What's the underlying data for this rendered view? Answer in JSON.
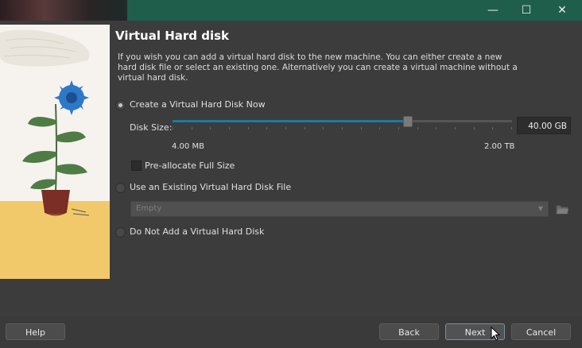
{
  "window": {
    "controls": {
      "minimize": "—",
      "maximize": "☐",
      "close": "✕"
    }
  },
  "dialog": {
    "title": "Virtual Hard disk",
    "description": "If you wish you can add a virtual hard disk to the new machine. You can either create a new hard disk file or select an existing one. Alternatively you can create a virtual machine without a virtual hard disk."
  },
  "options": {
    "create_new": {
      "label": "Create a Virtual Hard Disk Now",
      "selected": true
    },
    "use_existing": {
      "label": "Use an Existing Virtual Hard Disk File",
      "selected": false
    },
    "no_disk": {
      "label": "Do Not Add a Virtual Hard Disk",
      "selected": false
    }
  },
  "disk_size": {
    "label": "Disk Size:",
    "value": "40.00 GB",
    "min_label": "4.00 MB",
    "max_label": "2.00 TB",
    "slider_fraction": 0.69
  },
  "preallocate": {
    "label": "Pre-allocate Full Size",
    "checked": false
  },
  "existing_file": {
    "value": "Empty"
  },
  "buttons": {
    "help": "Help",
    "back": "Back",
    "next": "Next",
    "cancel": "Cancel"
  },
  "colors": {
    "titlebar": "#1f5e4b",
    "accent": "#1f78a0",
    "background": "#3c3c3c"
  },
  "icons": {
    "folder": "folder-open-icon",
    "cursor": "mouse-pointer-icon"
  }
}
